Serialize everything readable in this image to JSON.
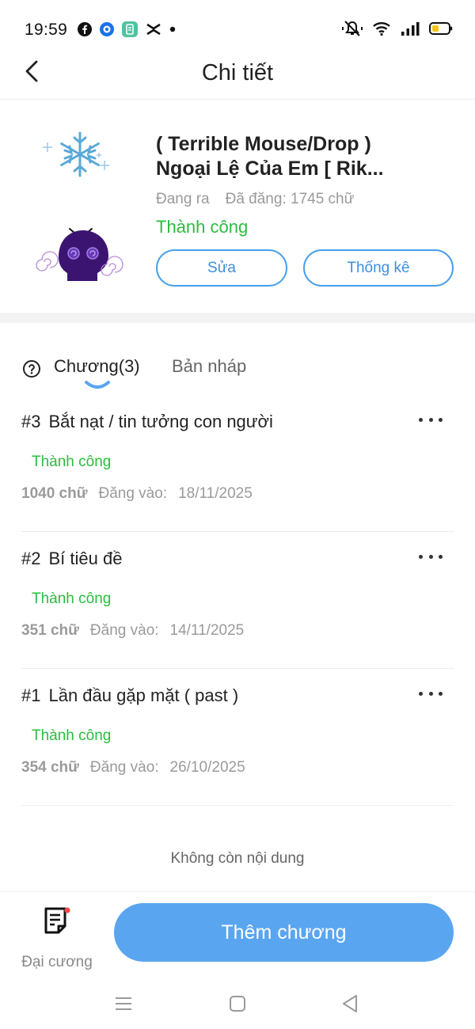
{
  "status_bar": {
    "time": "19:59",
    "left_icons": [
      "facebook-icon",
      "messenger-icon",
      "app-icon",
      "capcut-icon",
      "dot-icon"
    ],
    "right_icons": [
      "mute-icon",
      "wifi-icon",
      "signal-icon",
      "battery-icon"
    ]
  },
  "header": {
    "title": "Chi tiết",
    "back_icon": "chevron-left-icon"
  },
  "story": {
    "title_line1": "( Terrible Mouse/Drop )",
    "title_line2": "Ngoại Lệ Của Em [ Rik...",
    "state": "Đang ra",
    "posted_words": "Đã đăng: 1745 chữ",
    "status": "Thành công",
    "edit_label": "Sửa",
    "stats_label": "Thống kê"
  },
  "tabs": {
    "chapters_label": "Chương(3)",
    "drafts_label": "Bản nháp"
  },
  "chapters": [
    {
      "number": "#3",
      "title": "Bắt nạt / tin tưởng con người",
      "status": "Thành công",
      "words": "1040 chữ",
      "posted_label": "Đăng vào:",
      "date": "18/11/2025"
    },
    {
      "number": "#2",
      "title": "Bí tiêu đề",
      "status": "Thành công",
      "words": "351 chữ",
      "posted_label": "Đăng vào:",
      "date": "14/11/2025"
    },
    {
      "number": "#1",
      "title": "Lần đầu gặp mặt ( past )",
      "status": "Thành công",
      "words": "354 chữ",
      "posted_label": "Đăng vào:",
      "date": "26/10/2025"
    }
  ],
  "no_more_text": "Không còn nội dung",
  "bottom": {
    "outline_label": "Đại cương",
    "add_chapter_label": "Thêm chương"
  },
  "colors": {
    "accent": "#5aa5f0",
    "success": "#2bbd3f",
    "muted": "#9a9a9a"
  }
}
